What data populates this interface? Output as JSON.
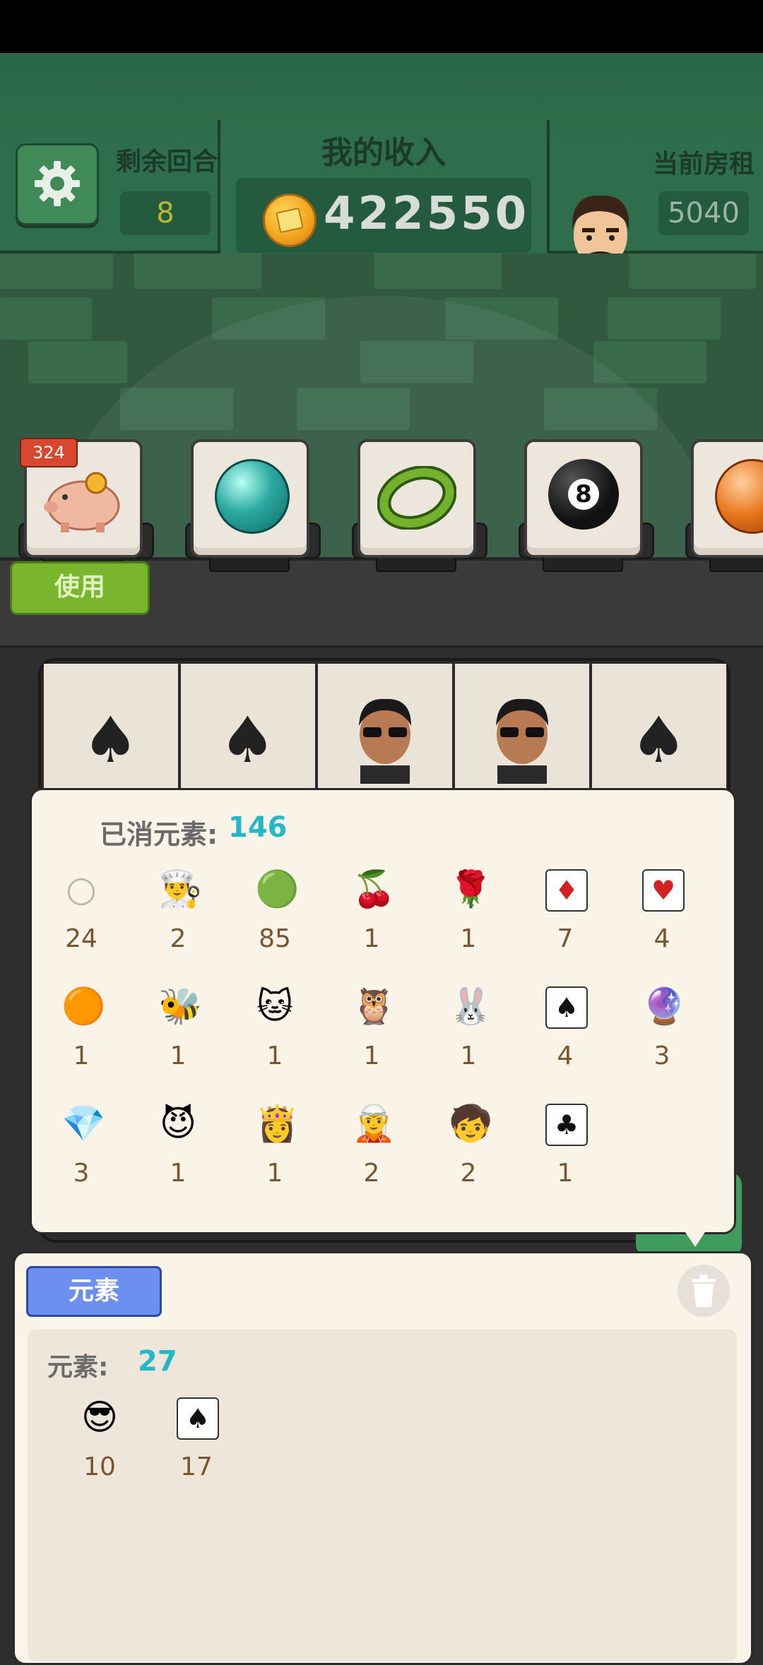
{
  "header": {
    "rounds_label": "剩余回合",
    "rounds_value": "8",
    "income_label": "我的收入",
    "income_value": "422550",
    "rent_label": "当前房租",
    "rent_value": "5040"
  },
  "slots": {
    "badge": "324",
    "use_label": "使用",
    "items": [
      "piggy-bank-icon",
      "teal-orb-icon",
      "green-ring-icon",
      "eight-ball-icon",
      "orange-orb-icon"
    ]
  },
  "board": {
    "cells": [
      "spade-cards-icon",
      "spade-cards-icon",
      "sunglasses-man-icon",
      "sunglasses-man-icon",
      "spade-cards-icon"
    ]
  },
  "popup": {
    "title": "已消元素:",
    "count": "146",
    "items": [
      {
        "icon": "empty-circle-icon",
        "glyph": "○",
        "count": "24"
      },
      {
        "icon": "chef-icon",
        "glyph": "👨‍🍳",
        "count": "2"
      },
      {
        "icon": "green-slime-icon",
        "glyph": "🟢",
        "count": "85"
      },
      {
        "icon": "cherry-icon",
        "glyph": "🍒",
        "count": "1"
      },
      {
        "icon": "rose-icon",
        "glyph": "🌹",
        "count": "1"
      },
      {
        "icon": "diamond-cards-icon",
        "glyph": "♦",
        "count": "7"
      },
      {
        "icon": "heart-cards-icon",
        "glyph": "♥",
        "count": "4"
      },
      {
        "icon": "amber-orb-icon",
        "glyph": "🟠",
        "count": "1"
      },
      {
        "icon": "bee-icon",
        "glyph": "🐝",
        "count": "1"
      },
      {
        "icon": "cat-icon",
        "glyph": "🐱",
        "count": "1"
      },
      {
        "icon": "owl-icon",
        "glyph": "🦉",
        "count": "1"
      },
      {
        "icon": "rabbit-icon",
        "glyph": "🐰",
        "count": "1"
      },
      {
        "icon": "spade-cards-icon",
        "glyph": "♠",
        "count": "4"
      },
      {
        "icon": "crystal-ball-icon",
        "glyph": "🔮",
        "count": "3"
      },
      {
        "icon": "purple-gem-icon",
        "glyph": "💎",
        "count": "3"
      },
      {
        "icon": "demon-icon",
        "glyph": "😈",
        "count": "1"
      },
      {
        "icon": "princess-icon",
        "glyph": "👸",
        "count": "1"
      },
      {
        "icon": "elf-icon",
        "glyph": "🧝",
        "count": "2"
      },
      {
        "icon": "red-hood-icon",
        "glyph": "🧒",
        "count": "2"
      },
      {
        "icon": "club-cards-icon",
        "glyph": "♣",
        "count": "1"
      }
    ]
  },
  "panel": {
    "tab_label": "元素",
    "title": "元素:",
    "count": "27",
    "items": [
      {
        "icon": "sunglasses-man-icon",
        "glyph": "😎",
        "count": "10"
      },
      {
        "icon": "spade-cards-icon",
        "glyph": "♠",
        "count": "17"
      }
    ]
  },
  "colors": {
    "header_green": "#2f6e4c",
    "accent_cyan": "#23b7c8",
    "count_brown": "#7a5630",
    "use_green": "#7ab52e",
    "tab_blue": "#6d8ff0"
  }
}
